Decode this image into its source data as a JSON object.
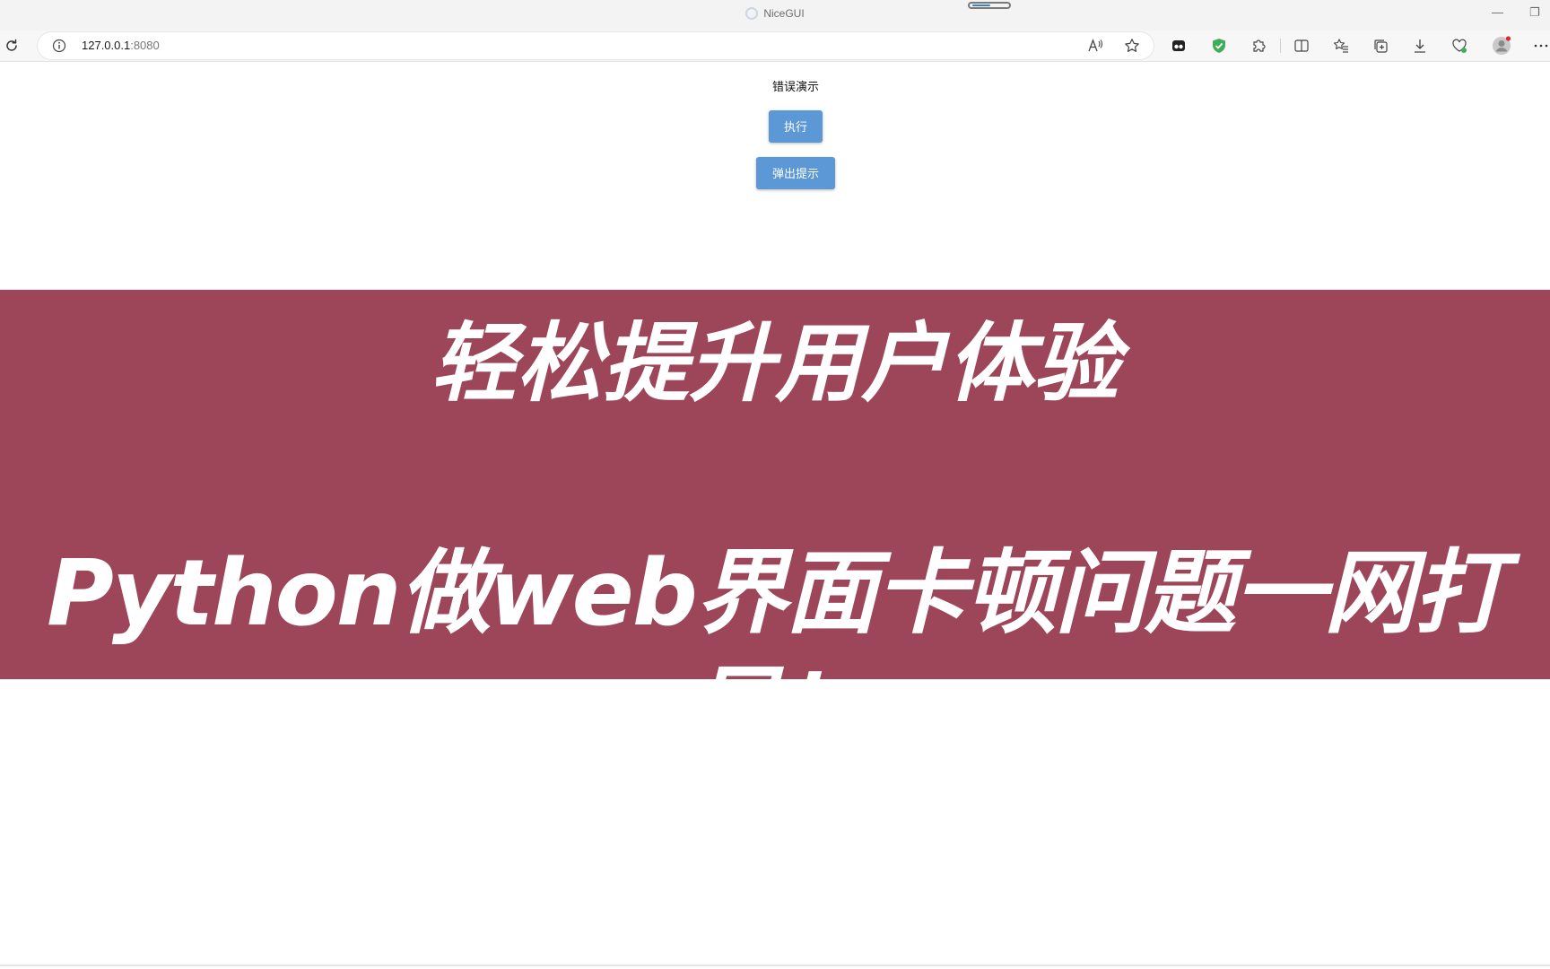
{
  "window": {
    "title": "NiceGUI",
    "minimize_glyph": "—",
    "restore_glyph": "❐"
  },
  "toolbar": {
    "url_host": "127.0.0.1",
    "url_port": ":8080",
    "icons": [
      "refresh-icon",
      "site-info-icon",
      "read-aloud-icon",
      "favorite-star-icon",
      "extension-icon",
      "shield-icon",
      "puzzle-icon",
      "split-screen-icon",
      "favorites-icon",
      "collections-icon",
      "download-icon",
      "performance-icon",
      "profile-avatar-icon",
      "more-icon"
    ]
  },
  "page": {
    "heading": "错误演示",
    "execute_button": "执行",
    "notify_button": "弹出提示"
  },
  "banner": {
    "line1": "轻松提升用户体验",
    "line2": "Python做web界面卡顿问题一网打尽！",
    "color": "#9e4659"
  },
  "colors": {
    "button": "#5b98d5",
    "shield": "#3fae5a"
  }
}
